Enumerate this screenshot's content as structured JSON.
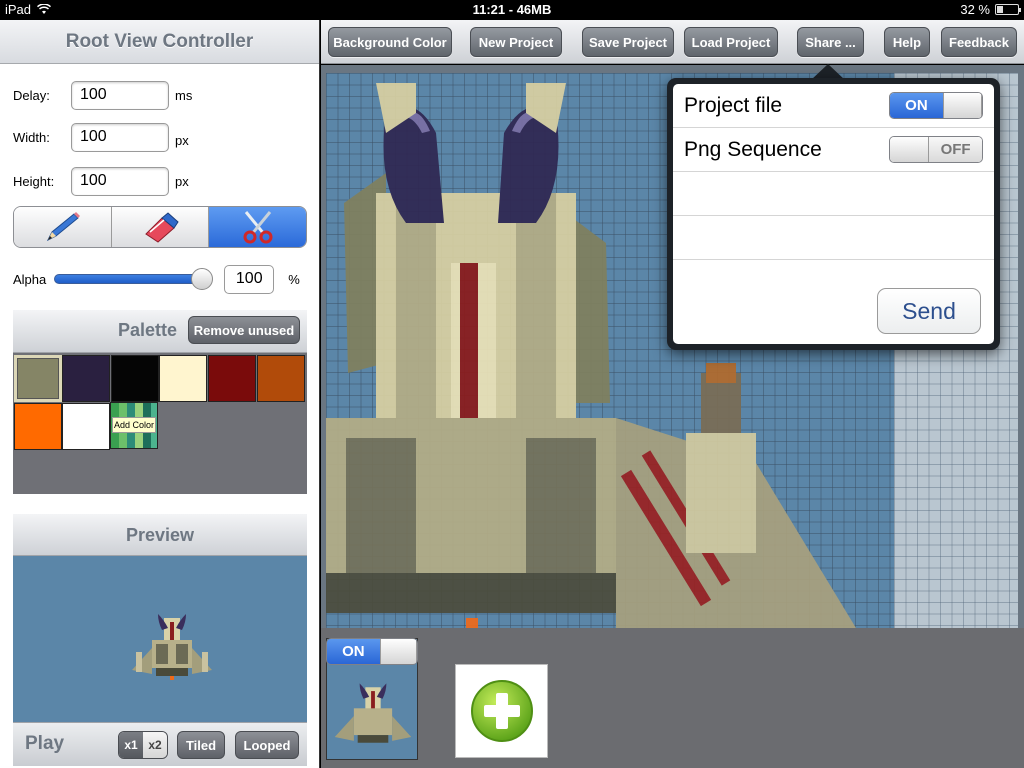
{
  "status": {
    "device": "iPad",
    "time_mem": "11:21 - 46MB",
    "battery": "32 %",
    "battery_level": 0.32
  },
  "left": {
    "title": "Root View Controller",
    "fields": {
      "delay": {
        "label": "Delay:",
        "value": "100",
        "unit": "ms"
      },
      "width": {
        "label": "Width:",
        "value": "100",
        "unit": "px"
      },
      "height": {
        "label": "Height:",
        "value": "100",
        "unit": "px"
      }
    },
    "tools": [
      {
        "name": "pencil-icon",
        "active": false
      },
      {
        "name": "eraser-icon",
        "active": false
      },
      {
        "name": "scissors-icon",
        "active": true
      }
    ],
    "alpha": {
      "label": "Alpha",
      "value": "100",
      "unit": "%",
      "level": 1.0
    },
    "palette": {
      "title": "Palette",
      "remove_label": "Remove unused",
      "add_color_label": "Add Color",
      "colors": [
        "#858566",
        "#2a2040",
        "#050505",
        "#fff5cf",
        "#7a0b0b",
        "#b14b0a",
        "#ff6a00",
        "#ffffff"
      ]
    },
    "preview": {
      "title": "Preview",
      "play_label": "Play",
      "zoom": [
        "x1",
        "x2"
      ],
      "tiled_label": "Tiled",
      "looped_label": "Looped"
    }
  },
  "toolbar": {
    "buttons": [
      "Background Color",
      "New Project",
      "Save Project",
      "Load Project",
      "Share ...",
      "Help",
      "Feedback"
    ]
  },
  "frames": {
    "toggle_on": "ON"
  },
  "share": {
    "rows": [
      {
        "label": "Project file",
        "state": "ON"
      },
      {
        "label": "Png Sequence",
        "state": "OFF"
      }
    ],
    "send_label": "Send"
  },
  "colors": {
    "canvas_bg": "#5b86a8",
    "accent_blue": "#2a66d6"
  }
}
